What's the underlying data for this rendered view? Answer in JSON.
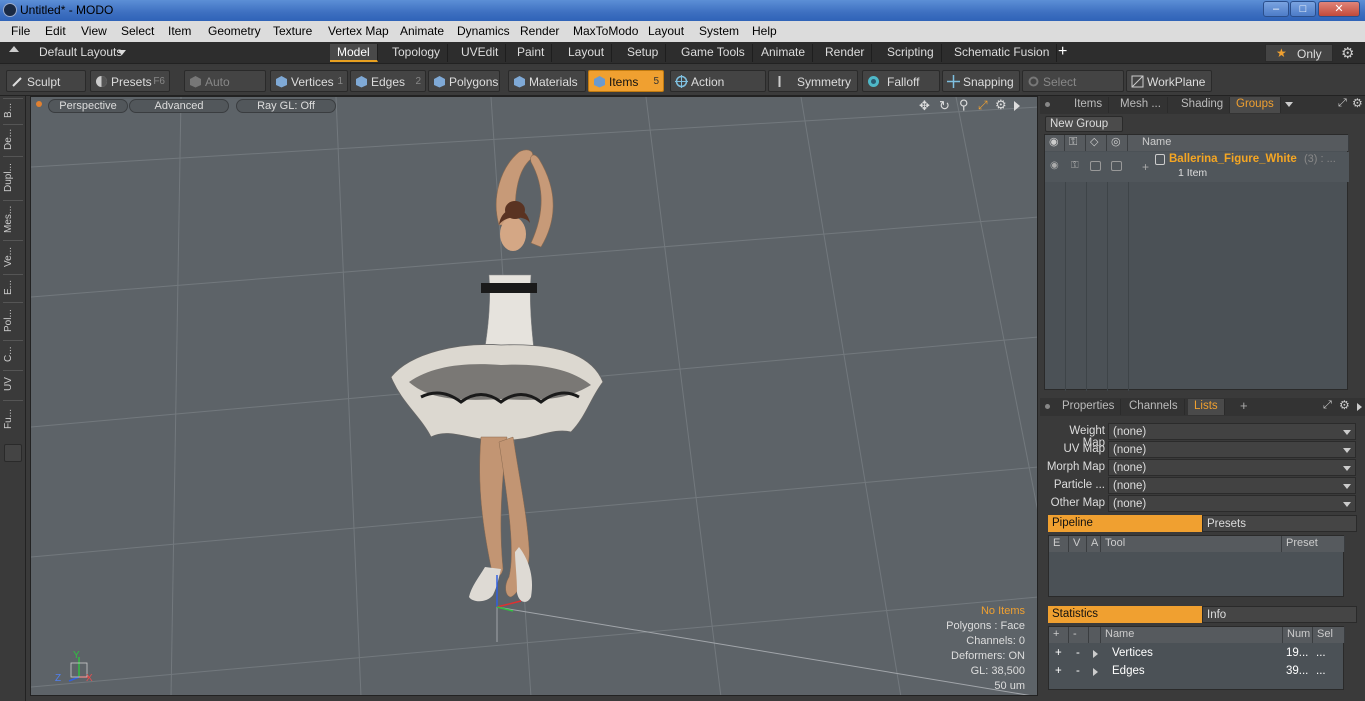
{
  "window": {
    "title": "Untitled* - MODO",
    "min": "–",
    "max": "□",
    "close": "✕"
  },
  "menu": [
    "File",
    "Edit",
    "View",
    "Select",
    "Item",
    "Geometry",
    "Texture",
    "Vertex Map",
    "Animate",
    "Dynamics",
    "Render",
    "MaxToModo",
    "Layout",
    "System",
    "Help"
  ],
  "layoutbar": {
    "layouts_label": "Default Layouts",
    "tabs": [
      "Model",
      "Topology",
      "UVEdit",
      "Paint",
      "Layout",
      "Setup",
      "Game Tools",
      "Animate",
      "Render",
      "Scripting",
      "Schematic Fusion"
    ],
    "active_tab": "Model",
    "plus": "+",
    "only_label": "Only",
    "star": "★"
  },
  "toolbar": {
    "sculpt": "Sculpt",
    "presets": "Presets",
    "presets_key": "F6",
    "auto_select": "Auto Select",
    "vertices": "Vertices",
    "vertices_key": "1",
    "edges": "Edges",
    "edges_key": "2",
    "polygons": "Polygons",
    "materials": "Materials",
    "items": "Items",
    "items_key": "5",
    "action_center": "Action Center",
    "symmetry": "Symmetry",
    "falloff": "Falloff",
    "snapping": "Snapping",
    "select_through": "Select Through",
    "workplane": "WorkPlane"
  },
  "leftbar": [
    "B...",
    "De...",
    "Dupl...",
    "Mes...",
    "Ve...",
    "E...",
    "Pol...",
    "C...",
    "UV",
    "Fu..."
  ],
  "viewport": {
    "perspective": "Perspective",
    "advanced": "Advanced",
    "raygl": "Ray GL: Off",
    "info": {
      "selection": "No Items",
      "polygons": "Polygons : Face",
      "channels": "Channels: 0",
      "deformers": "Deformers: ON",
      "gl": "GL: 38,500",
      "scale": "50 um"
    },
    "axis": {
      "x": "X",
      "y": "Y",
      "z": "Z"
    }
  },
  "items_panel": {
    "tabs": [
      "Items",
      "Mesh ...",
      "Shading",
      "Groups"
    ],
    "active_tab": "Groups",
    "new_group": "New Group",
    "name_header": "Name",
    "group_name": "Ballerina_Figure_White",
    "group_count": "(3) : ...",
    "group_sub": "1 Item"
  },
  "props_panel": {
    "tabs": [
      "Properties",
      "Channels",
      "Lists"
    ],
    "active_tab": "Lists",
    "plus": "+",
    "maps": [
      {
        "label": "Weight Map",
        "value": "(none)"
      },
      {
        "label": "UV Map",
        "value": "(none)"
      },
      {
        "label": "Morph Map",
        "value": "(none)"
      },
      {
        "label": "Particle ...",
        "value": "(none)"
      },
      {
        "label": "Other Map",
        "value": "(none)"
      }
    ],
    "pipeline": "Pipeline",
    "presets": "Presets",
    "pipeline_cols": [
      "E",
      "V",
      "A",
      "Tool",
      "Preset"
    ],
    "statistics": "Statistics",
    "info": "Info",
    "stats_cols": [
      "+",
      "-",
      "Name",
      "Num",
      "Sel"
    ],
    "stats_rows": [
      {
        "plus": "+",
        "minus": "-",
        "name": "Vertices",
        "num": "19...",
        "sel": "..."
      },
      {
        "plus": "+",
        "minus": "-",
        "name": "Edges",
        "num": "39...",
        "sel": "..."
      }
    ]
  },
  "colors": {
    "accent": "#f0a030",
    "selected_text": "#f5a623"
  }
}
